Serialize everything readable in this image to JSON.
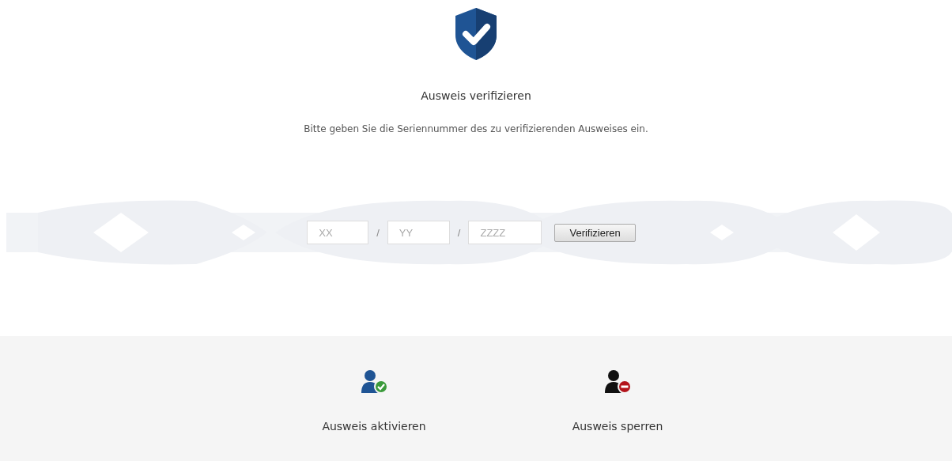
{
  "title": "Ausweis verifizieren",
  "instruction": "Bitte geben Sie die Seriennummer des zu verifizierenden Ausweises ein.",
  "serial_fields": [
    {
      "placeholder": "XX",
      "separator": "/"
    },
    {
      "placeholder": "YY",
      "separator": "/"
    },
    {
      "placeholder": "ZZZZ"
    }
  ],
  "submit_button": "Verifizieren",
  "actions": [
    {
      "label": "Ausweis aktivieren",
      "kind": "activate"
    },
    {
      "label": "Ausweis sperren",
      "kind": "block"
    }
  ]
}
